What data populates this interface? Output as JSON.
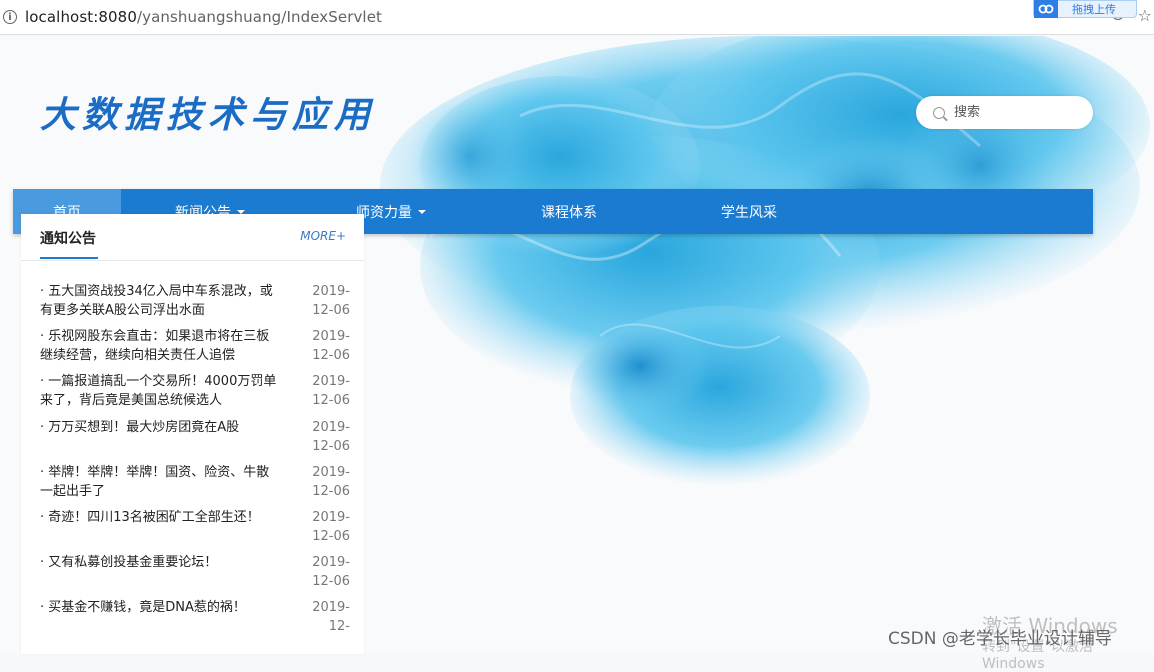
{
  "browser": {
    "url_host": "localhost:8080",
    "url_path": "/yanshuangshuang/IndexServlet",
    "baidu_upload_label": "拖拽上传"
  },
  "header": {
    "site_title": "大数据技术与应用",
    "search_placeholder": "搜索"
  },
  "nav": {
    "items": [
      {
        "label": "首页",
        "has_dropdown": false,
        "active": true
      },
      {
        "label": "新闻公告",
        "has_dropdown": true
      },
      {
        "label": "师资力量",
        "has_dropdown": true
      },
      {
        "label": "课程体系",
        "has_dropdown": false
      },
      {
        "label": "学生风采",
        "has_dropdown": false
      }
    ]
  },
  "notice": {
    "title": "通知公告",
    "more": "MORE+",
    "items": [
      {
        "title": "· 五大国资战投34亿入局中车系混改，或有更多关联A股公司浮出水面",
        "date": "2019-12-06"
      },
      {
        "title": "· 乐视网股东会直击：如果退市将在三板继续经营，继续向相关责任人追偿",
        "date": "2019-12-06"
      },
      {
        "title": "· 一篇报道搞乱一个交易所！4000万罚单来了，背后竟是美国总统候选人",
        "date": "2019-12-06"
      },
      {
        "title": "· 万万买想到！最大炒房团竟在A股",
        "date": "2019-12-06"
      },
      {
        "title": "· 举牌！举牌！举牌！国资、险资、牛散一起出手了",
        "date": "2019-12-06"
      },
      {
        "title": "· 奇迹！四川13名被困矿工全部生还！",
        "date": "2019-12-06"
      },
      {
        "title": "· 又有私募创投基金重要论坛！",
        "date": "2019-12-06"
      },
      {
        "title": "· 买基金不赚钱，竟是DNA惹的祸！",
        "date": "2019-12-"
      }
    ]
  },
  "overlay": {
    "watermark": "CSDN @老学长毕业设计辅导",
    "windows_activate": "激活 Windows",
    "windows_activate_sub": "转到\"设置\"以激活 Windows"
  },
  "colors": {
    "nav": "#1a7bd0",
    "nav_active": "#4a9ae0",
    "title": "#1a6cc4",
    "ink": "#3fb8e6"
  }
}
